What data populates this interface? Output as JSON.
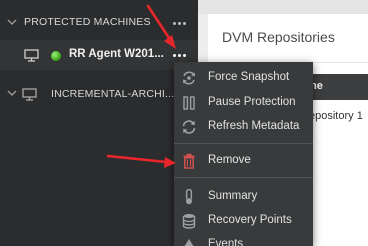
{
  "nav": {
    "groups": [
      {
        "label": "PROTECTED MACHINES",
        "expanded": true
      },
      {
        "label": "INCREMENTAL-ARCHI...",
        "expanded": false
      }
    ],
    "machines": [
      {
        "name": "RR Agent W201...",
        "status": "online",
        "status_color": "#3fae1e"
      }
    ]
  },
  "main": {
    "title": "DVM Repositories",
    "table": {
      "column_fragment": "me",
      "cell_fragment": "epository 1"
    }
  },
  "context_menu": {
    "items": [
      {
        "label": "Force Snapshot",
        "icon": "camera-sync-icon"
      },
      {
        "label": "Pause Protection",
        "icon": "pause-icon"
      },
      {
        "label": "Refresh Metadata",
        "icon": "refresh-icon"
      },
      {
        "label": "Remove",
        "icon": "trash-icon",
        "accent": "#d9534f"
      },
      {
        "label": "Summary",
        "icon": "summary-icon"
      },
      {
        "label": "Recovery Points",
        "icon": "database-icon"
      },
      {
        "label": "Events",
        "icon": "events-icon"
      }
    ]
  },
  "annotations": {
    "arrow_color": "#e8262b"
  }
}
